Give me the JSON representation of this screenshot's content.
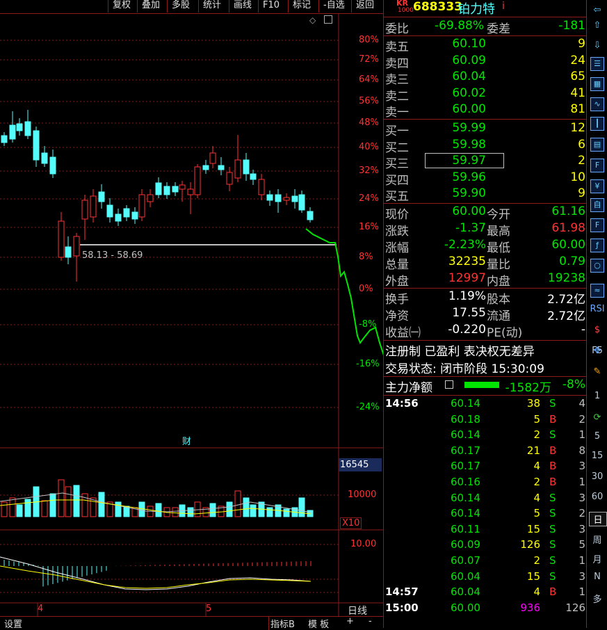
{
  "toolbar": {
    "items": [
      "复权",
      "叠加",
      "多股",
      "统计",
      "画线",
      "F10",
      "标记",
      "-自选",
      "返回"
    ]
  },
  "header": {
    "badge_top": "KR",
    "badge_bottom": "1000",
    "code": "688333",
    "name": "铂力特",
    "info_mark": "i"
  },
  "chart": {
    "pct_ticks": [
      "80%",
      "72%",
      "64%",
      "56%",
      "48%",
      "40%",
      "32%",
      "24%",
      "16%",
      "8%",
      "0%",
      "-8%",
      "-16%",
      "-24%"
    ],
    "range_label": "58.13 - 58.69",
    "fin_marker": "财",
    "volume_box": "16545",
    "volume_tick": "10000",
    "volume_unit": "X10",
    "macd_tick": "10.00",
    "month_labels": [
      "4",
      "5"
    ],
    "period_label": "日线"
  },
  "bottom": {
    "settings": "设置",
    "indicator": "指标B",
    "template": "模 板",
    "plus": "+",
    "minus": "-"
  },
  "quote": {
    "wei_bi_label": "委比",
    "wei_bi": "-69.88%",
    "wei_cha_label": "委差",
    "wei_cha": "-181",
    "asks": [
      {
        "label": "卖五",
        "price": "60.10",
        "vol": "9"
      },
      {
        "label": "卖四",
        "price": "60.09",
        "vol": "24"
      },
      {
        "label": "卖三",
        "price": "60.04",
        "vol": "65"
      },
      {
        "label": "卖二",
        "price": "60.02",
        "vol": "41"
      },
      {
        "label": "卖一",
        "price": "60.00",
        "vol": "81"
      }
    ],
    "bids": [
      {
        "label": "买一",
        "price": "59.99",
        "vol": "12"
      },
      {
        "label": "买二",
        "price": "59.98",
        "vol": "6"
      },
      {
        "label": "买三",
        "price": "59.97",
        "vol": "2"
      },
      {
        "label": "买四",
        "price": "59.96",
        "vol": "10"
      },
      {
        "label": "买五",
        "price": "59.90",
        "vol": "9"
      }
    ],
    "stats": [
      {
        "l1": "现价",
        "v1": "60.00",
        "c1": "green",
        "l2": "今开",
        "v2": "61.16",
        "c2": "green"
      },
      {
        "l1": "涨跌",
        "v1": "-1.37",
        "c1": "green",
        "l2": "最高",
        "v2": "61.98",
        "c2": "red"
      },
      {
        "l1": "涨幅",
        "v1": "-2.23%",
        "c1": "green",
        "l2": "最低",
        "v2": "60.00",
        "c2": "green"
      },
      {
        "l1": "总量",
        "v1": "32235",
        "c1": "yellow",
        "l2": "量比",
        "v2": "0.79",
        "c2": "green"
      },
      {
        "l1": "外盘",
        "v1": "12997",
        "c1": "red",
        "l2": "内盘",
        "v2": "19238",
        "c2": "green"
      }
    ],
    "fund": [
      {
        "l1": "换手",
        "v1": "1.19%",
        "l2": "股本",
        "v2": "2.72亿"
      },
      {
        "l1": "净资",
        "v1": "17.55",
        "l2": "流通",
        "v2": "2.72亿"
      },
      {
        "l1": "收益㈠",
        "v1": "-0.220",
        "l2": "PE(动)",
        "v2": "-"
      }
    ],
    "tags": "注册制 已盈利 表决权无差异",
    "trade_state": "交易状态: 闭市阶段 15:30:09",
    "main_net_label": "主力净额",
    "main_net_value": "-1582万",
    "main_net_pct": "-8%",
    "ticks": [
      {
        "t": "14:56",
        "p": "60.14",
        "v": "38",
        "d": "S",
        "n": "4"
      },
      {
        "t": "",
        "p": "60.18",
        "v": "5",
        "d": "B",
        "n": "2"
      },
      {
        "t": "",
        "p": "60.14",
        "v": "2",
        "d": "S",
        "n": "1"
      },
      {
        "t": "",
        "p": "60.17",
        "v": "21",
        "d": "B",
        "n": "8"
      },
      {
        "t": "",
        "p": "60.17",
        "v": "4",
        "d": "B",
        "n": "3"
      },
      {
        "t": "",
        "p": "60.16",
        "v": "2",
        "d": "B",
        "n": "1"
      },
      {
        "t": "",
        "p": "60.14",
        "v": "4",
        "d": "S",
        "n": "3"
      },
      {
        "t": "",
        "p": "60.14",
        "v": "5",
        "d": "S",
        "n": "2"
      },
      {
        "t": "",
        "p": "60.11",
        "v": "15",
        "d": "S",
        "n": "3"
      },
      {
        "t": "",
        "p": "60.09",
        "v": "126",
        "d": "S",
        "n": "5"
      },
      {
        "t": "",
        "p": "60.07",
        "v": "2",
        "d": "S",
        "n": "1"
      },
      {
        "t": "",
        "p": "60.04",
        "v": "15",
        "d": "S",
        "n": "3"
      },
      {
        "t": "14:57",
        "p": "60.04",
        "v": "4",
        "d": "B",
        "n": "1"
      },
      {
        "t": "15:00",
        "p": "60.00",
        "v": "936",
        "d": "",
        "n": "126"
      }
    ]
  },
  "iconbar": {
    "icons": [
      "left-arrow-icon",
      "up-arrow-icon",
      "down-arrow-icon",
      "quote-list-icon",
      "grid-icon",
      "line-chart-icon",
      "candle-chart-icon",
      "news-icon",
      "f10-icon",
      "finance-icon",
      "self-select-icon",
      "f2-icon",
      "fx-icon",
      "circle-icon",
      "wave-icon"
    ],
    "labels": [
      "RSI",
      "F5",
      "1",
      "5",
      "15",
      "30",
      "60",
      "日",
      "周",
      "月",
      "N",
      "多"
    ]
  },
  "colors": {
    "up": "#ff3232",
    "down": "#00e600",
    "cyan": "#54fcfc",
    "border": "#8b1a1a"
  }
}
